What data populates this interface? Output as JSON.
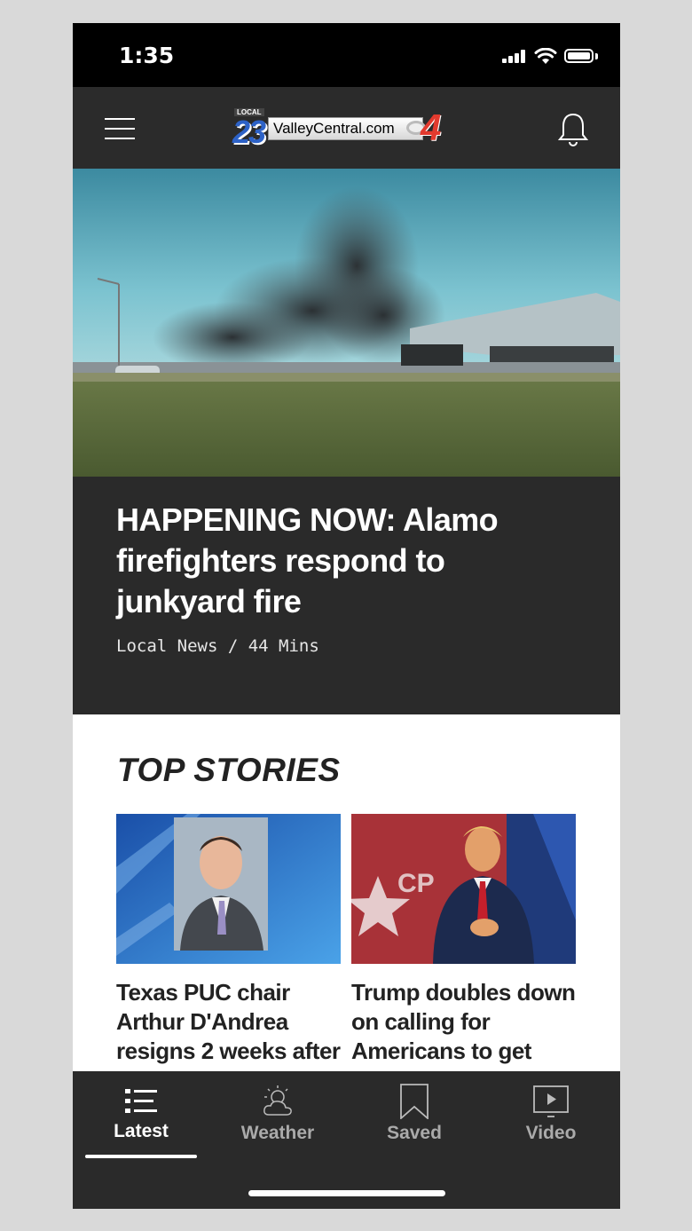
{
  "status_bar": {
    "time": "1:35"
  },
  "header": {
    "logo": {
      "local": "LOCAL",
      "number_left": "23",
      "site": "ValleyCentral.com",
      "number_right": "4"
    }
  },
  "hero": {
    "headline": "HAPPENING NOW: Alamo firefighters respond to junkyard fire",
    "meta": "Local News / 44 Mins"
  },
  "top_stories": {
    "title": "TOP STORIES",
    "items": [
      {
        "title": "Texas PUC chair Arthur D'Andrea resigns 2 weeks after"
      },
      {
        "title": "Trump doubles down on calling for Americans to get"
      }
    ]
  },
  "bottom_nav": {
    "tabs": [
      {
        "label": "Latest",
        "active": true
      },
      {
        "label": "Weather",
        "active": false
      },
      {
        "label": "Saved",
        "active": false
      },
      {
        "label": "Video",
        "active": false
      }
    ]
  }
}
